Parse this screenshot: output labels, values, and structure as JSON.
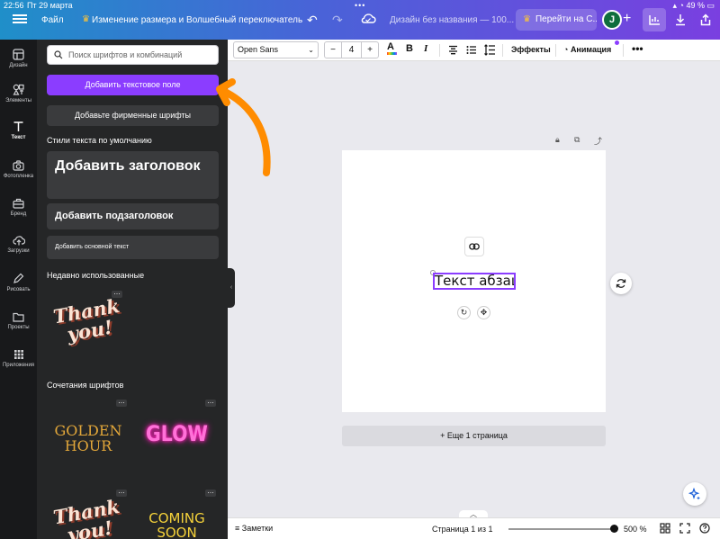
{
  "status_bar": {
    "time": "22:56",
    "date": "Пт 29 марта",
    "battery": "49 %"
  },
  "topbar": {
    "file_label": "Файл",
    "project_name": "Изменение размера и Волшебный переключатель",
    "design_title": "Дизайн без названия — 100...",
    "pro_button": "Перейти на С...",
    "avatar_letter": "J"
  },
  "rail": [
    {
      "label": "Дизайн",
      "icon": "layout-icon"
    },
    {
      "label": "Элементы",
      "icon": "shapes-icon"
    },
    {
      "label": "Текст",
      "icon": "text-icon",
      "active": true
    },
    {
      "label": "Фотопленка",
      "icon": "camera-icon"
    },
    {
      "label": "Бренд",
      "icon": "briefcase-icon"
    },
    {
      "label": "Загрузки",
      "icon": "upload-cloud-icon"
    },
    {
      "label": "Рисовать",
      "icon": "pen-icon"
    },
    {
      "label": "Проекты",
      "icon": "folder-icon"
    },
    {
      "label": "Приложения",
      "icon": "apps-grid-icon"
    }
  ],
  "panel": {
    "search_placeholder": "Поиск шрифтов и комбинаций",
    "add_textbox": "Добавить текстовое поле",
    "add_brand_fonts": "Добавьте фирменные шрифты",
    "default_styles_title": "Стили текста по умолчанию",
    "heading": "Добавить заголовок",
    "subheading": "Добавить подзаголовок",
    "body_text": "Добавить основной текст",
    "recent_title": "Недавно использованные",
    "combos_title": "Сочетания шрифтов",
    "thumbs": {
      "thank_you": "Thank you!",
      "golden_hour": "GOLDEN HOUR",
      "glow": "GLOW",
      "coming_soon": "COMING SOON"
    }
  },
  "toolbar": {
    "font": "Open Sans",
    "font_size": "4",
    "effects": "Эффекты",
    "animation": "Анимация"
  },
  "canvas": {
    "text_element": "Текст абзаца",
    "add_page": "+ Еще 1 страница"
  },
  "bottombar": {
    "notes": "Заметки",
    "page_info": "Страница 1 из 1",
    "zoom": "500 %"
  },
  "colors": {
    "accent": "#8b3dff",
    "highlight_arrow": "#ff8c00"
  }
}
